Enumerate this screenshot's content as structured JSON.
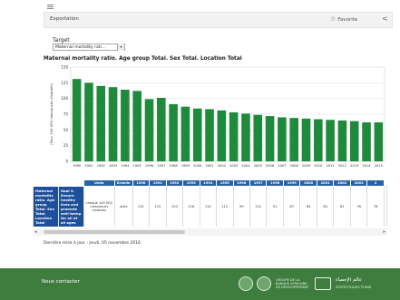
{
  "toolbar": {
    "title": "Exportation",
    "favorite_label": "Favorite",
    "share_icon": "share-icon",
    "star_icon": "star-icon"
  },
  "target": {
    "label": "Target",
    "value": "Maternal mortality rati..."
  },
  "chart_title": "Maternal mortality ratio. Age group Total. Sex Total. Location Total",
  "chart_data": {
    "type": "bar",
    "title": "Maternal mortality ratio. Age group Total. Sex Total. Location Total",
    "ylabel": "(Pour 100 000 naissances vivantes)",
    "ylim": [
      0,
      150
    ],
    "yticks": [
      "0",
      "25",
      "50",
      "75",
      "100",
      "125",
      "150"
    ],
    "categories": [
      "1990",
      "1991",
      "1992",
      "1993",
      "1994",
      "1995",
      "1996",
      "1997",
      "1998",
      "1999",
      "2000",
      "2001",
      "2002",
      "2003",
      "2004",
      "2005",
      "2006",
      "2007",
      "2008",
      "2009",
      "2010",
      "2011",
      "2012",
      "2013",
      "2014",
      "2015"
    ],
    "values": [
      131,
      125,
      120,
      118,
      114,
      112,
      99,
      101,
      91,
      87,
      84,
      83,
      81,
      78,
      76,
      74,
      72,
      70,
      69,
      68,
      67,
      66,
      65,
      64,
      62,
      62
    ],
    "color": "#1f8a3c",
    "grid": true
  },
  "table": {
    "headers": [
      "Units",
      "Échelle",
      "1990",
      "1991",
      "1992",
      "1993",
      "1994",
      "1995",
      "1996",
      "1997",
      "1998",
      "1999",
      "2000",
      "2001",
      "2002",
      "2003",
      "2"
    ],
    "row_head_1": "Maternal mortality ratio. Age group Total. Sex Total. Location Total",
    "row_head_2": "Goal 3. Ensure healthy lives and promote well-being for all at all ages",
    "units": "cheque 100 000 naissances vivantes",
    "scale": "units",
    "values": [
      "131",
      "125",
      "120",
      "118",
      "114",
      "112",
      "99",
      "101",
      "91",
      "87",
      "84",
      "83",
      "81",
      "78",
      "76"
    ]
  },
  "last_update": "Dernière mise à jour : jeudi, 05 novembre 2016",
  "footer": {
    "contact": "Nous contacter",
    "afdb": "GROUPE DE LA BANQUE AFRICAINE DE DÉVELOPPEMENT",
    "stat_name": "عالم الإحصاء",
    "stat_sub": "STATISTIQUES TUNIS"
  }
}
